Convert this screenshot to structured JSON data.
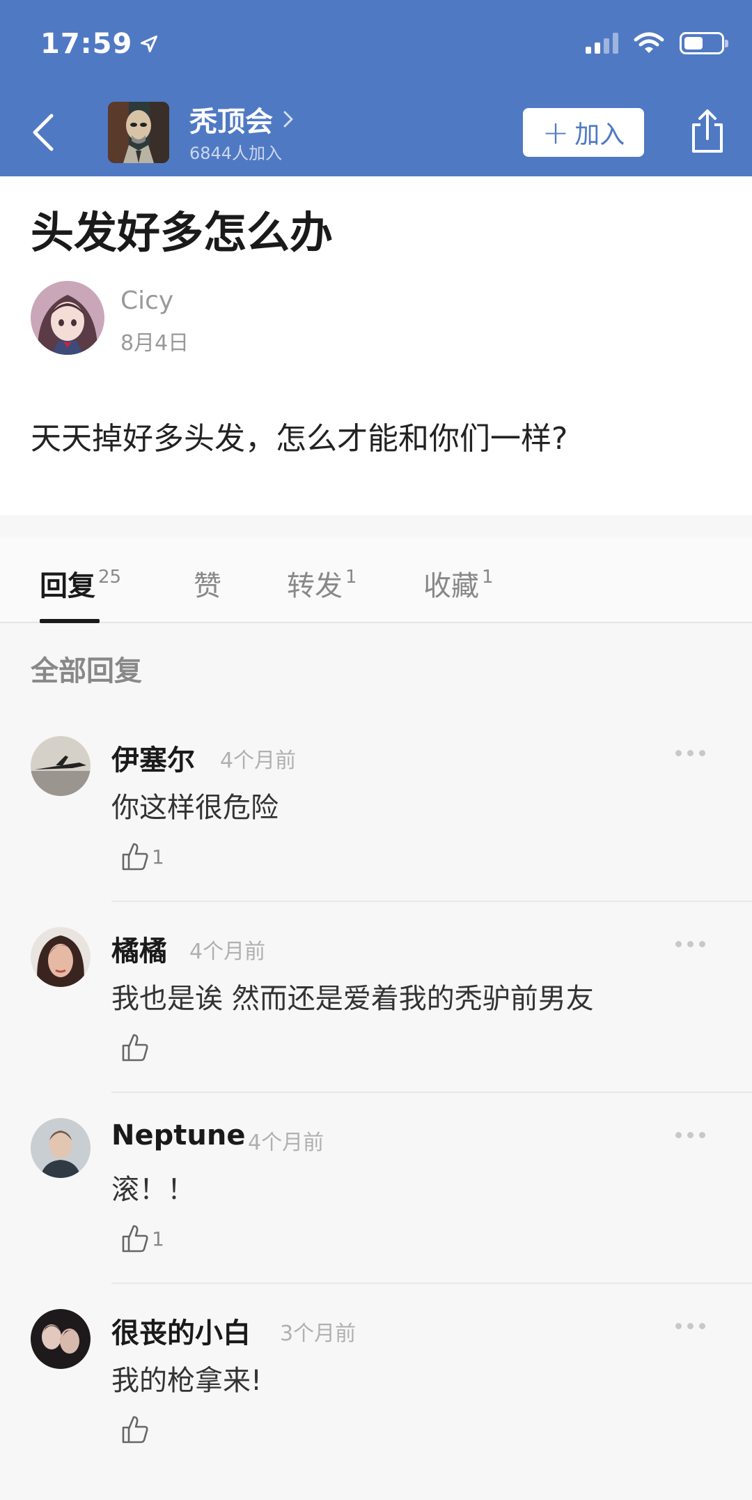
{
  "status_bar": {
    "time": "17:59"
  },
  "header": {
    "group_name": "秃顶会",
    "member_count": "6844人加入",
    "join_label": "加入",
    "accent_color": "#5079c4"
  },
  "post": {
    "title": "头发好多怎么办",
    "author": "Cicy",
    "date": "8月4日",
    "body": "天天掉好多头发，怎么才能和你们一样?"
  },
  "tabs": [
    {
      "label": "回复",
      "count": "25"
    },
    {
      "label": "赞",
      "count": ""
    },
    {
      "label": "转发",
      "count": "1"
    },
    {
      "label": "收藏",
      "count": "1"
    }
  ],
  "section_title": "全部回复",
  "comments": [
    {
      "name": "伊塞尔",
      "time": "4个月前",
      "text": "你这样很危险",
      "likes": "1"
    },
    {
      "name": "橘橘",
      "time": "4个月前",
      "text": "我也是诶 然而还是爱着我的秃驴前男友",
      "likes": ""
    },
    {
      "name": "Neptune",
      "time": "4个月前",
      "text": "滚！！",
      "likes": "1"
    },
    {
      "name": "很丧的小白",
      "time": "3个月前",
      "text": "我的枪拿来!",
      "likes": ""
    }
  ]
}
